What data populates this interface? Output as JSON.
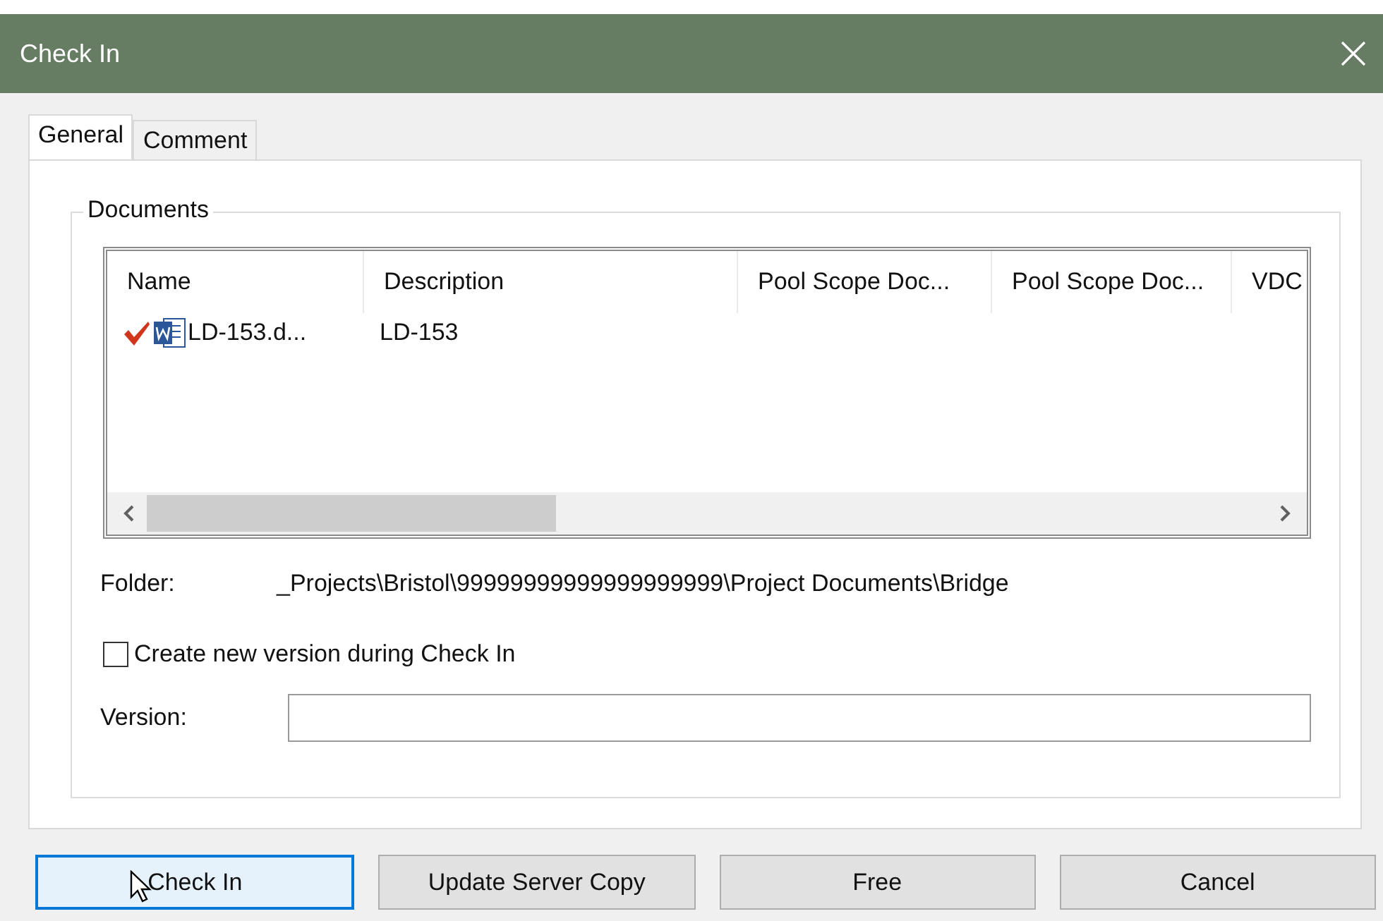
{
  "window": {
    "title": "Check In"
  },
  "tabs": [
    {
      "label": "General",
      "selected": true
    },
    {
      "label": "Comment",
      "selected": false
    }
  ],
  "documents": {
    "title": "Documents",
    "columns": [
      "Name",
      "Description",
      "Pool Scope Doc...",
      "Pool Scope Doc...",
      "VDC"
    ],
    "rows": [
      {
        "checked": true,
        "cells": [
          "LD-153.d...",
          "LD-153"
        ]
      }
    ]
  },
  "folder": {
    "label": "Folder:",
    "value": "_Projects\\Bristol\\99999999999999999999\\Project Documents\\Bridge"
  },
  "create_new_version": {
    "label": "Create new version during Check In",
    "checked": false
  },
  "version": {
    "label": "Version:"
  },
  "buttons": [
    {
      "label": "Check In",
      "focused": true
    },
    {
      "label": "Update Server Copy",
      "focused": false
    },
    {
      "label": "Free",
      "focused": false
    },
    {
      "label": "Cancel",
      "focused": false
    }
  ]
}
